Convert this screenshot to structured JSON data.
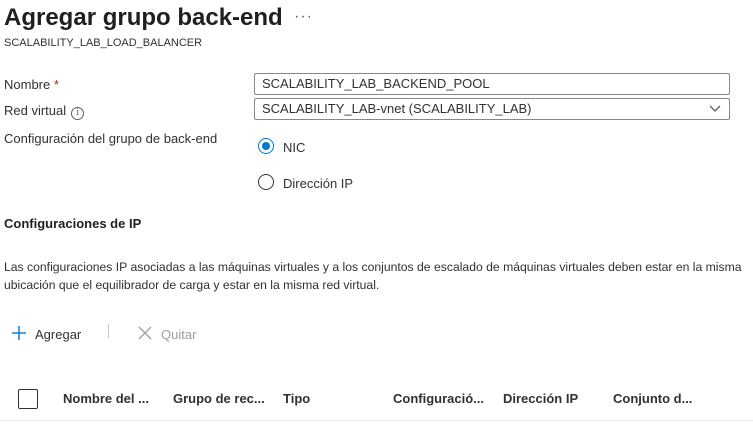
{
  "header": {
    "title": "Agregar grupo back-end",
    "more": "···",
    "subtitle": "SCALABILITY_LAB_LOAD_BALANCER"
  },
  "form": {
    "name_label": "Nombre",
    "required_mark": "*",
    "name_value": "SCALABILITY_LAB_BACKEND_POOL",
    "vnet_label": "Red virtual",
    "vnet_info": "i",
    "vnet_value": "SCALABILITY_LAB-vnet (SCALABILITY_LAB)",
    "config_label": "Configuración del grupo de back-end",
    "options": [
      {
        "label": "NIC",
        "selected": true
      },
      {
        "label": "Dirección IP",
        "selected": false
      }
    ]
  },
  "ip_section": {
    "heading": "Configuraciones de IP",
    "description": "Las configuraciones IP asociadas a las máquinas virtuales y a los conjuntos de escalado de máquinas virtuales deben estar en la misma ubicación que el equilibrador de carga y estar en la misma red virtual."
  },
  "toolbar": {
    "add_label": "Agregar",
    "add_icon": "plus-icon",
    "separator": "|",
    "remove_label": "Quitar",
    "remove_icon": "close-icon"
  },
  "table": {
    "columns": [
      "Nombre del ...",
      "Grupo de rec...",
      "Tipo",
      "Configuració...",
      "Dirección IP",
      "Conjunto d..."
    ]
  },
  "colors": {
    "accent": "#0078d4",
    "required": "#a4262c",
    "disabled": "#a19f9d"
  }
}
